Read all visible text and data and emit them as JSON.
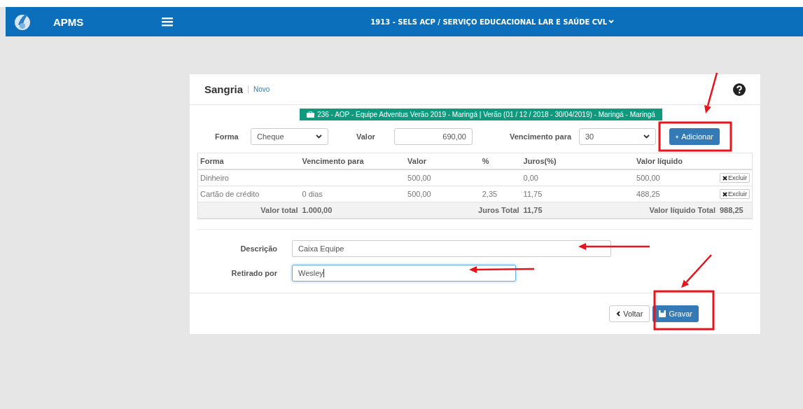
{
  "header": {
    "app_name": "APMS",
    "organization": "1913 - SELS ACP / SERVIÇO EDUCACIONAL LAR E SAÚDE CVL"
  },
  "card": {
    "title": "Sangria",
    "subtitle": "Novo",
    "banner": "236 - AOP - Equipe Adventus Verão 2019 - Maringá | Verão (01 / 12 / 2018 - 30/04/2019) - Maringá - Maringá"
  },
  "form": {
    "forma_label": "Forma",
    "forma_value": "Cheque",
    "valor_label": "Valor",
    "valor_value": "690,00",
    "vencimento_label": "Vencimento para",
    "vencimento_value": "30",
    "add_button": "Adicionar"
  },
  "table": {
    "columns": [
      "Forma",
      "Vencimento para",
      "Valor",
      "%",
      "Juros(%)",
      "Valor líquido"
    ],
    "rows": [
      {
        "cells": [
          "Dinheiro",
          "",
          "500,00",
          "",
          "0,00",
          "500,00"
        ],
        "action": "Excluir"
      },
      {
        "cells": [
          "Cartão de crédito",
          "0 dias",
          "500,00",
          "2,35",
          "11,75",
          "488,25"
        ],
        "action": "Excluir"
      }
    ],
    "totals": [
      {
        "label": "Valor total",
        "value": "1.000,00"
      },
      {
        "label": "Juros Total",
        "value": "11,75"
      },
      {
        "label": "Valor líquido Total",
        "value": "988,25"
      }
    ]
  },
  "details": [
    {
      "label": "Descrição",
      "value": "Caixa Equipe",
      "focused": false
    },
    {
      "label": "Retirado por",
      "value": "Wesley",
      "focused": true
    }
  ],
  "buttons": {
    "back": "Voltar",
    "save": "Gravar"
  }
}
